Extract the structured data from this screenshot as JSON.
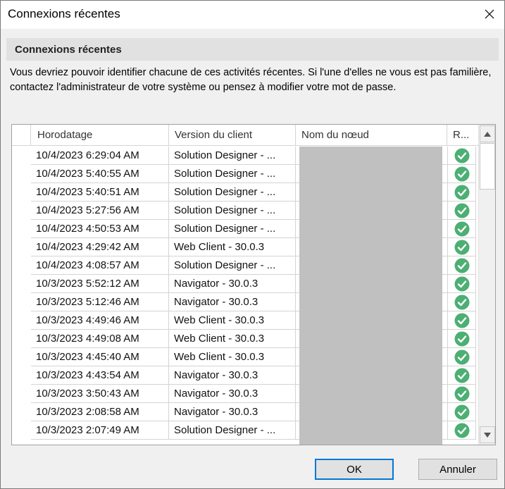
{
  "window": {
    "title": "Connexions récentes",
    "close_icon": "close-icon"
  },
  "section": {
    "title": "Connexions récentes"
  },
  "description": "Vous devriez pouvoir identifier chacune de ces activités récentes. Si l'une d'elles ne vous est pas familière, contactez l'administrateur de votre système ou pensez à modifier votre mot de passe.",
  "table": {
    "columns": {
      "timestamp": "Horodatage",
      "client_version": "Version du client",
      "node_name": "Nom du nœud",
      "result": "R..."
    },
    "rows": [
      {
        "timestamp": "10/4/2023 6:29:04 AM",
        "client_version": "Solution Designer - ..."
      },
      {
        "timestamp": "10/4/2023 5:40:55 AM",
        "client_version": "Solution Designer - ..."
      },
      {
        "timestamp": "10/4/2023 5:40:51 AM",
        "client_version": "Solution Designer - ..."
      },
      {
        "timestamp": "10/4/2023 5:27:56 AM",
        "client_version": "Solution Designer - ..."
      },
      {
        "timestamp": "10/4/2023 4:50:53 AM",
        "client_version": "Solution Designer - ..."
      },
      {
        "timestamp": "10/4/2023 4:29:42 AM",
        "client_version": "Web Client - 30.0.3"
      },
      {
        "timestamp": "10/4/2023 4:08:57 AM",
        "client_version": "Solution Designer - ..."
      },
      {
        "timestamp": "10/3/2023 5:52:12 AM",
        "client_version": "Navigator - 30.0.3"
      },
      {
        "timestamp": "10/3/2023 5:12:46 AM",
        "client_version": "Navigator - 30.0.3"
      },
      {
        "timestamp": "10/3/2023 4:49:46 AM",
        "client_version": "Web Client - 30.0.3"
      },
      {
        "timestamp": "10/3/2023 4:49:08 AM",
        "client_version": "Web Client - 30.0.3"
      },
      {
        "timestamp": "10/3/2023 4:45:40 AM",
        "client_version": "Web Client - 30.0.3"
      },
      {
        "timestamp": "10/3/2023 4:43:54 AM",
        "client_version": "Navigator - 30.0.3"
      },
      {
        "timestamp": "10/3/2023 3:50:43 AM",
        "client_version": "Navigator - 30.0.3"
      },
      {
        "timestamp": "10/3/2023 2:08:58 AM",
        "client_version": "Navigator - 30.0.3"
      },
      {
        "timestamp": "10/3/2023 2:07:49 AM",
        "client_version": "Solution Designer - ..."
      }
    ],
    "result_icon": "check-circle-icon",
    "result_color": "#4caf73"
  },
  "buttons": {
    "ok": "OK",
    "cancel": "Annuler"
  },
  "colors": {
    "ok_border": "#0078d7",
    "node_mask": "#c0c0c0"
  }
}
